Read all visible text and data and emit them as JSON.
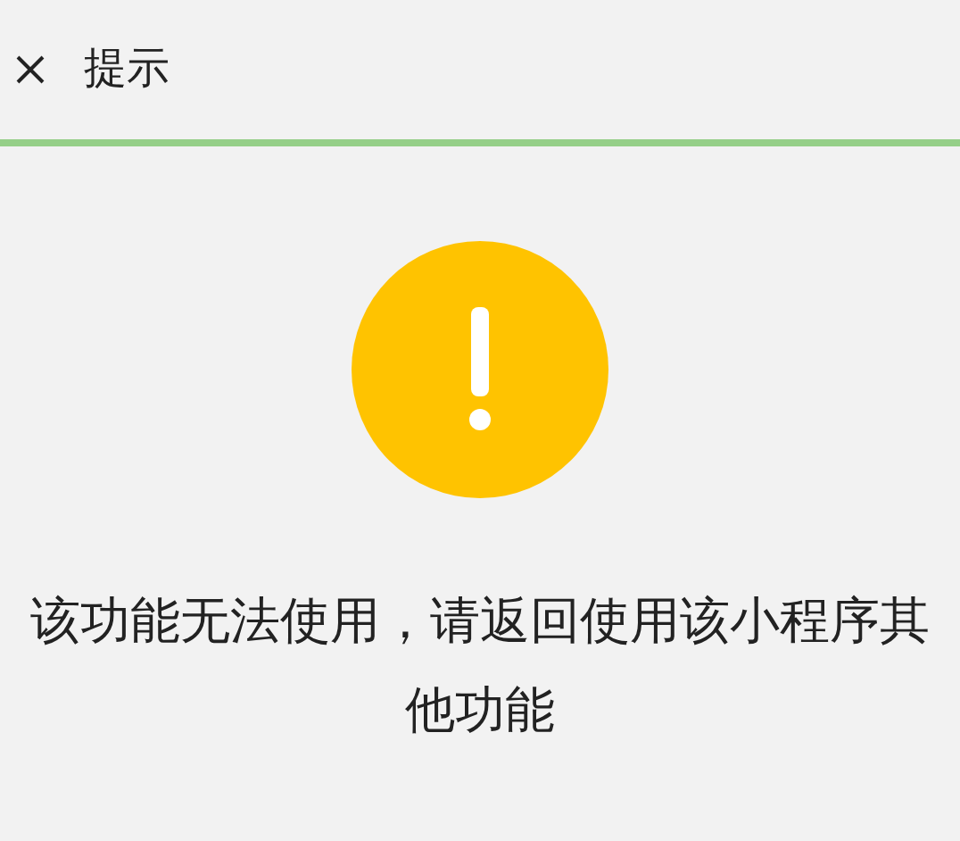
{
  "header": {
    "title": "提示"
  },
  "message": "该功能无法使用，请返回使用该小程序其他功能"
}
